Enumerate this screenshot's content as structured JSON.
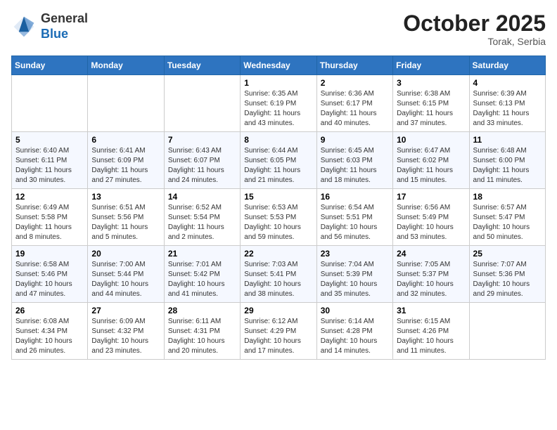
{
  "header": {
    "logo": {
      "general": "General",
      "blue": "Blue"
    },
    "title": "October 2025",
    "subtitle": "Torak, Serbia"
  },
  "calendar": {
    "days_of_week": [
      "Sunday",
      "Monday",
      "Tuesday",
      "Wednesday",
      "Thursday",
      "Friday",
      "Saturday"
    ],
    "weeks": [
      [
        {
          "day": "",
          "info": ""
        },
        {
          "day": "",
          "info": ""
        },
        {
          "day": "",
          "info": ""
        },
        {
          "day": "1",
          "info": "Sunrise: 6:35 AM\nSunset: 6:19 PM\nDaylight: 11 hours\nand 43 minutes."
        },
        {
          "day": "2",
          "info": "Sunrise: 6:36 AM\nSunset: 6:17 PM\nDaylight: 11 hours\nand 40 minutes."
        },
        {
          "day": "3",
          "info": "Sunrise: 6:38 AM\nSunset: 6:15 PM\nDaylight: 11 hours\nand 37 minutes."
        },
        {
          "day": "4",
          "info": "Sunrise: 6:39 AM\nSunset: 6:13 PM\nDaylight: 11 hours\nand 33 minutes."
        }
      ],
      [
        {
          "day": "5",
          "info": "Sunrise: 6:40 AM\nSunset: 6:11 PM\nDaylight: 11 hours\nand 30 minutes."
        },
        {
          "day": "6",
          "info": "Sunrise: 6:41 AM\nSunset: 6:09 PM\nDaylight: 11 hours\nand 27 minutes."
        },
        {
          "day": "7",
          "info": "Sunrise: 6:43 AM\nSunset: 6:07 PM\nDaylight: 11 hours\nand 24 minutes."
        },
        {
          "day": "8",
          "info": "Sunrise: 6:44 AM\nSunset: 6:05 PM\nDaylight: 11 hours\nand 21 minutes."
        },
        {
          "day": "9",
          "info": "Sunrise: 6:45 AM\nSunset: 6:03 PM\nDaylight: 11 hours\nand 18 minutes."
        },
        {
          "day": "10",
          "info": "Sunrise: 6:47 AM\nSunset: 6:02 PM\nDaylight: 11 hours\nand 15 minutes."
        },
        {
          "day": "11",
          "info": "Sunrise: 6:48 AM\nSunset: 6:00 PM\nDaylight: 11 hours\nand 11 minutes."
        }
      ],
      [
        {
          "day": "12",
          "info": "Sunrise: 6:49 AM\nSunset: 5:58 PM\nDaylight: 11 hours\nand 8 minutes."
        },
        {
          "day": "13",
          "info": "Sunrise: 6:51 AM\nSunset: 5:56 PM\nDaylight: 11 hours\nand 5 minutes."
        },
        {
          "day": "14",
          "info": "Sunrise: 6:52 AM\nSunset: 5:54 PM\nDaylight: 11 hours\nand 2 minutes."
        },
        {
          "day": "15",
          "info": "Sunrise: 6:53 AM\nSunset: 5:53 PM\nDaylight: 10 hours\nand 59 minutes."
        },
        {
          "day": "16",
          "info": "Sunrise: 6:54 AM\nSunset: 5:51 PM\nDaylight: 10 hours\nand 56 minutes."
        },
        {
          "day": "17",
          "info": "Sunrise: 6:56 AM\nSunset: 5:49 PM\nDaylight: 10 hours\nand 53 minutes."
        },
        {
          "day": "18",
          "info": "Sunrise: 6:57 AM\nSunset: 5:47 PM\nDaylight: 10 hours\nand 50 minutes."
        }
      ],
      [
        {
          "day": "19",
          "info": "Sunrise: 6:58 AM\nSunset: 5:46 PM\nDaylight: 10 hours\nand 47 minutes."
        },
        {
          "day": "20",
          "info": "Sunrise: 7:00 AM\nSunset: 5:44 PM\nDaylight: 10 hours\nand 44 minutes."
        },
        {
          "day": "21",
          "info": "Sunrise: 7:01 AM\nSunset: 5:42 PM\nDaylight: 10 hours\nand 41 minutes."
        },
        {
          "day": "22",
          "info": "Sunrise: 7:03 AM\nSunset: 5:41 PM\nDaylight: 10 hours\nand 38 minutes."
        },
        {
          "day": "23",
          "info": "Sunrise: 7:04 AM\nSunset: 5:39 PM\nDaylight: 10 hours\nand 35 minutes."
        },
        {
          "day": "24",
          "info": "Sunrise: 7:05 AM\nSunset: 5:37 PM\nDaylight: 10 hours\nand 32 minutes."
        },
        {
          "day": "25",
          "info": "Sunrise: 7:07 AM\nSunset: 5:36 PM\nDaylight: 10 hours\nand 29 minutes."
        }
      ],
      [
        {
          "day": "26",
          "info": "Sunrise: 6:08 AM\nSunset: 4:34 PM\nDaylight: 10 hours\nand 26 minutes."
        },
        {
          "day": "27",
          "info": "Sunrise: 6:09 AM\nSunset: 4:32 PM\nDaylight: 10 hours\nand 23 minutes."
        },
        {
          "day": "28",
          "info": "Sunrise: 6:11 AM\nSunset: 4:31 PM\nDaylight: 10 hours\nand 20 minutes."
        },
        {
          "day": "29",
          "info": "Sunrise: 6:12 AM\nSunset: 4:29 PM\nDaylight: 10 hours\nand 17 minutes."
        },
        {
          "day": "30",
          "info": "Sunrise: 6:14 AM\nSunset: 4:28 PM\nDaylight: 10 hours\nand 14 minutes."
        },
        {
          "day": "31",
          "info": "Sunrise: 6:15 AM\nSunset: 4:26 PM\nDaylight: 10 hours\nand 11 minutes."
        },
        {
          "day": "",
          "info": ""
        }
      ]
    ]
  }
}
